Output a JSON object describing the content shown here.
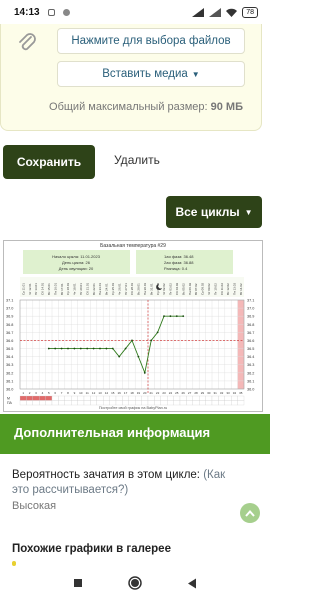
{
  "status_bar": {
    "time": "14:13",
    "battery": "78"
  },
  "upload": {
    "choose_files_label": "Нажмите для выбора файлов",
    "insert_media_label": "Вставить медиа",
    "max_size_label": "Общий максимальный размер:",
    "max_size_value": "90 МБ"
  },
  "actions": {
    "save_label": "Сохранить",
    "delete_label": "Удалить",
    "all_cycles_label": "Все циклы"
  },
  "chart_data": {
    "type": "line",
    "title": "Базальная температура #29",
    "info": {
      "cycle_start": "Начало цикла: 11.01.2023",
      "cycle_day": "День цикла: 26",
      "ovulation_day": "День овуляции: 20",
      "phase1": "1ая фаза: 36.48",
      "phase2": "2ая фаза: 36.88",
      "difference": "Разница: 0.4"
    },
    "dates": [
      "11.01",
      "12.01",
      "13.01",
      "14.01",
      "15.01",
      "16.01",
      "17.01",
      "18.01",
      "19.01",
      "20.01",
      "21.01",
      "22.01",
      "23.01",
      "24.01",
      "25.01",
      "26.01",
      "27.01",
      "28.01",
      "29.01",
      "30.01",
      "31.01",
      "01.02",
      "02.02",
      "03.02",
      "04.02",
      "05.02",
      "06.02",
      "07.02",
      "08.02",
      "09.02",
      "10.02",
      "11.02",
      "12.02",
      "13.02",
      "14.02"
    ],
    "weekdays": [
      "Ср",
      "Чт",
      "Пт",
      "Сб",
      "Вс",
      "Пн",
      "Вт",
      "Ср",
      "Чт",
      "Пт",
      "Сб",
      "Вс",
      "Пн",
      "Вт",
      "Ср",
      "Чт",
      "Пт",
      "Сб",
      "Вс",
      "Пн",
      "Вт",
      "Ср",
      "Чт",
      "Пт",
      "Сб",
      "Вс",
      "Пн",
      "Вт",
      "Ср",
      "Чт",
      "Пт",
      "Сб",
      "Вс",
      "Пн",
      "Вт"
    ],
    "days": [
      1,
      2,
      3,
      4,
      5,
      6,
      7,
      8,
      9,
      10,
      11,
      12,
      13,
      14,
      15,
      16,
      17,
      18,
      19,
      20,
      21,
      22,
      23,
      24,
      25,
      26,
      27,
      28,
      29,
      30,
      31,
      32,
      33,
      34,
      35
    ],
    "y_ticks": [
      "37.1",
      "37.0",
      "36.9",
      "36.8",
      "36.7",
      "36.6",
      "36.5",
      "36.4",
      "36.3",
      "36.2",
      "36.1",
      "36.0"
    ],
    "ylim": [
      36.0,
      37.1
    ],
    "series": [
      {
        "x": [
          5,
          6,
          7,
          8,
          9,
          10,
          11,
          12,
          13,
          14,
          15,
          16,
          17,
          18,
          19,
          20,
          21,
          22,
          23,
          24,
          25,
          26
        ],
        "y": [
          36.5,
          36.5,
          36.5,
          36.5,
          36.5,
          36.5,
          36.5,
          36.5,
          36.5,
          36.5,
          36.5,
          36.4,
          36.5,
          36.6,
          36.4,
          36.2,
          36.6,
          36.7,
          36.9,
          36.9,
          36.9,
          36.9
        ]
      }
    ],
    "coverline": 36.6,
    "ovulation_day": 20,
    "menstruation_days": [
      1,
      2,
      3,
      4,
      5
    ],
    "row_labels": [
      "М",
      "ПА"
    ],
    "footer": "Постройте свой график на BabyPlan.ru"
  },
  "additional": {
    "header": "Дополнительная информация",
    "question": "Вероятность зачатия в этом цикле:",
    "question_link": "(Как это рассчитывается?)",
    "probability": "Высокая",
    "similar_title": "Похожие графики в галерее"
  },
  "colors": {
    "dark_green": "#2e4318",
    "green": "#4f9a22",
    "link": "#2a5f7a",
    "chart_line": "#2e7a1a",
    "coverline": "#d02020",
    "period": "#e06a6a"
  }
}
